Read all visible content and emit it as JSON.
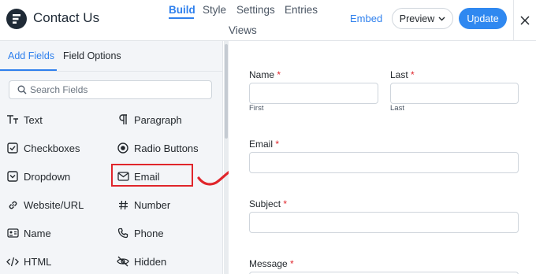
{
  "header": {
    "title": "Contact Us",
    "tabs": [
      {
        "label": "Build",
        "active": true
      },
      {
        "label": "Style",
        "active": false
      },
      {
        "label": "Settings",
        "active": false
      },
      {
        "label": "Entries",
        "active": false
      },
      {
        "label": "Views",
        "active": false
      }
    ],
    "embed_label": "Embed",
    "preview_label": "Preview",
    "update_label": "Update"
  },
  "sidebar": {
    "tabs": [
      {
        "label": "Add Fields",
        "active": true
      },
      {
        "label": "Field Options",
        "active": false
      }
    ],
    "search_placeholder": "Search Fields",
    "fields": [
      {
        "label": "Text",
        "icon": "text-icon"
      },
      {
        "label": "Paragraph",
        "icon": "paragraph-icon"
      },
      {
        "label": "Checkboxes",
        "icon": "checkbox-icon"
      },
      {
        "label": "Radio Buttons",
        "icon": "radio-icon"
      },
      {
        "label": "Dropdown",
        "icon": "dropdown-icon"
      },
      {
        "label": "Email",
        "icon": "envelope-icon",
        "highlighted": true
      },
      {
        "label": "Website/URL",
        "icon": "link-icon"
      },
      {
        "label": "Number",
        "icon": "hash-icon"
      },
      {
        "label": "Name",
        "icon": "id-card-icon"
      },
      {
        "label": "Phone",
        "icon": "phone-icon"
      },
      {
        "label": "HTML",
        "icon": "code-icon"
      },
      {
        "label": "Hidden",
        "icon": "eye-slash-icon"
      }
    ]
  },
  "form": {
    "name_label": "Name",
    "first_sub": "First",
    "last_label": "Last",
    "last_sub": "Last",
    "email_label": "Email",
    "subject_label": "Subject",
    "message_label": "Message",
    "required_mark": "*"
  },
  "colors": {
    "accent": "#2f80ed",
    "required": "#e0252b",
    "highlight_border": "#e0252b",
    "sidebar_bg": "#f3f5f8",
    "logo_bg": "#1f2a36"
  }
}
